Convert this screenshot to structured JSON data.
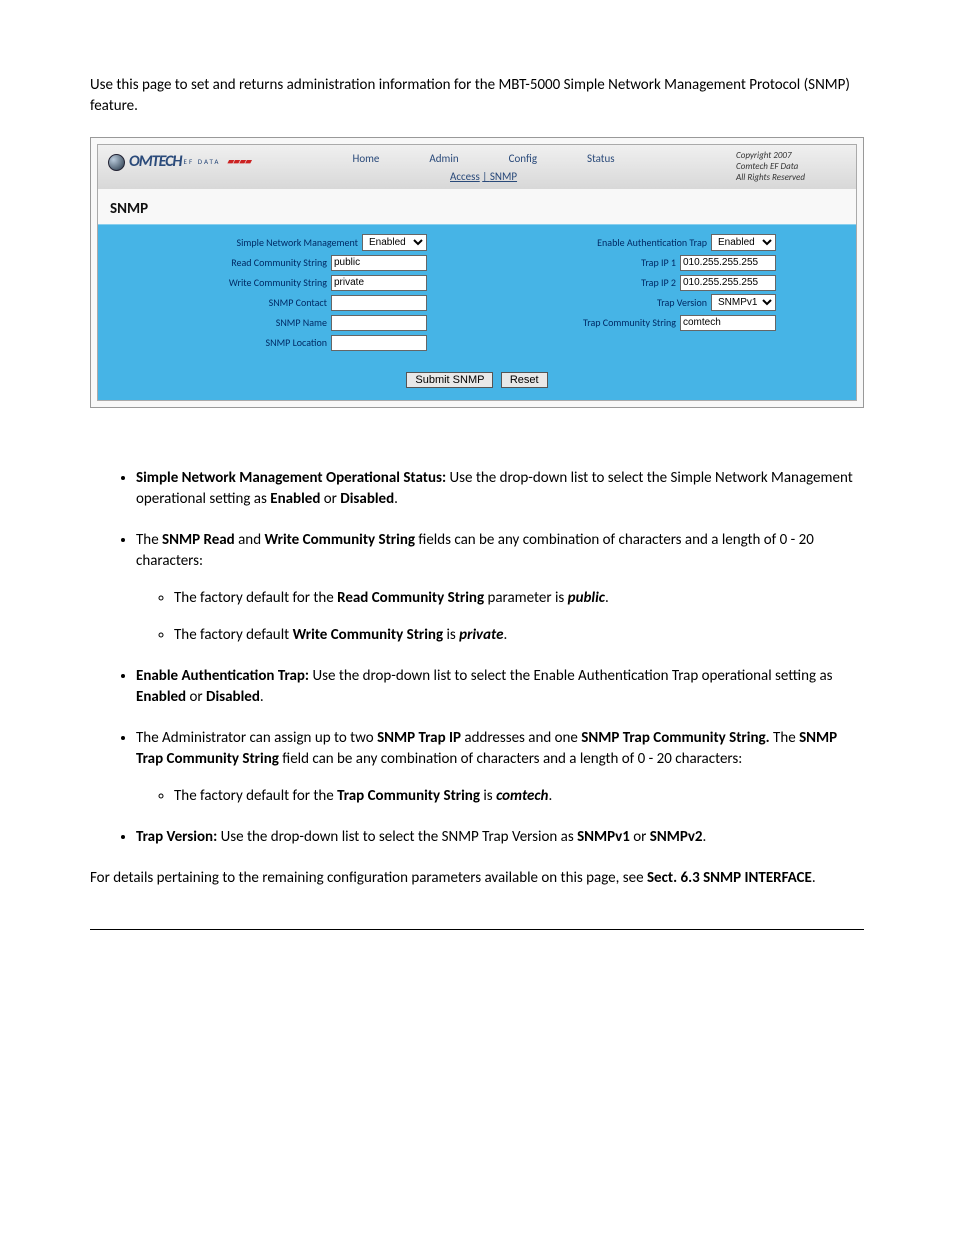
{
  "intro": "Use this page to set and returns administration information for the MBT-5000 Simple Network Management Protocol (SNMP) feature.",
  "app": {
    "logo": "OMTECH",
    "logo_sub": "EF DATA",
    "nav": {
      "home": "Home",
      "admin": "Admin",
      "config": "Config",
      "status": "Status"
    },
    "subnav_access": "Access",
    "subnav_sep": "| ",
    "subnav_snmp": "SNMP",
    "copy1": "Copyright 2007",
    "copy2": "Comtech EF Data",
    "copy3": "All Rights Reserved",
    "title": "SNMP",
    "left": {
      "l1": "Simple Network Management",
      "l2": "Read Community String",
      "l3": "Write Community String",
      "l4": "SNMP Contact",
      "l5": "SNMP Name",
      "l6": "SNMP Location",
      "v1": "Enabled",
      "v2": "public",
      "v3": "private",
      "v4": "",
      "v5": "",
      "v6": ""
    },
    "right": {
      "l1": "Enable Authentication Trap",
      "l2": "Trap IP 1",
      "l3": "Trap IP 2",
      "l4": "Trap Version",
      "l5": "Trap Community String",
      "v1": "Enabled",
      "v2": "010.255.255.255",
      "v3": "010.255.255.255",
      "v4": "SNMPv1",
      "v5": "comtech"
    },
    "btn_submit": "Submit SNMP",
    "btn_reset": "Reset"
  },
  "bullets": {
    "b1_strong": "Simple Network Management Operational Status: ",
    "b1_t1": "Use the drop-down list to select the Simple Network Management operational setting as ",
    "b1_e": "Enabled",
    "b1_or": " or ",
    "b1_d": "Disabled",
    "b1_dot": ".",
    "b2_t1": "The ",
    "b2_s1": "SNMP Read",
    "b2_t2": " and ",
    "b2_s2": "Write Community String",
    "b2_t3": " fields can be any combination of characters and a length of 0 - 20 characters:",
    "b2s1_t1": "The factory default for the ",
    "b2s1_s1": "Read Community String",
    "b2s1_t2": " parameter is ",
    "b2s1_e1": "public",
    "b2s2_t1": "The factory default ",
    "b2s2_s1": "Write Community String",
    "b2s2_t2": " is ",
    "b2s2_e1": "private",
    "b3_s1": "Enable Authentication Trap: ",
    "b3_t1": "Use the drop-down list to select the Enable Authentication Trap operational setting as ",
    "b3_e": "Enabled",
    "b3_or": " or ",
    "b3_d": "Disabled",
    "b4_t1": "The Administrator can assign up to two ",
    "b4_s1": "SNMP Trap IP",
    "b4_t2": " addresses and one ",
    "b4_s2": "SNMP Trap Community String.",
    "b4_t3": " The ",
    "b4_s3": "SNMP Trap Community String",
    "b4_t4": " field can be any combination of characters and a length of 0 - 20 characters:",
    "b4s1_t1": "The factory default for the ",
    "b4s1_s1": "Trap Community String",
    "b4s1_t2": " is ",
    "b4s1_e1": "comtech",
    "b5_s1": "Trap Version: ",
    "b5_t1": "Use the drop-down list to select the SNMP Trap Version as ",
    "b5_v1": "SNMPv1",
    "b5_or": " or ",
    "b5_v2": "SNMPv2"
  },
  "closing_t1": "For details pertaining to the remaining configuration parameters available on this page, see ",
  "closing_s1": "Sect. 6.3 SNMP INTERFACE",
  "closing_dot": "."
}
